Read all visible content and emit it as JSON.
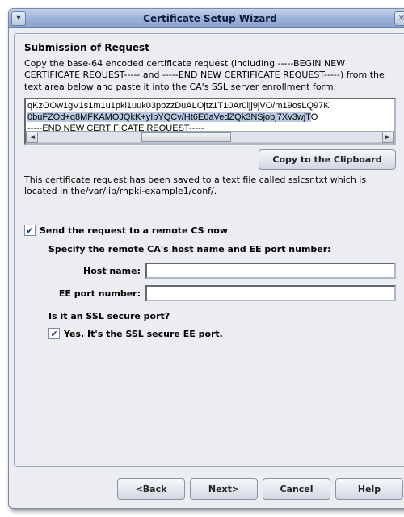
{
  "window": {
    "title": "Certificate Setup Wizard"
  },
  "section": {
    "heading": "Submission of Request",
    "instruction": "Copy the base-64 encoded certificate request (including -----BEGIN NEW CERTIFICATE REQUEST----- and -----END NEW CERTIFICATE REQUEST-----) from the text area below and paste it into the CA's SSL server enrollment form.",
    "cert_line1": "qKzOOw1gV1s1m1u1pkl1uuk03pbzzDuALOjtz1T10Ar0ijj9jVO/m19osLQ97K",
    "cert_line2_sel": "0buFZOd+q8MFKAMOJQkK+yIbYQCv/Ht6E6aVedZQk3NSjobj7Xv3wjT",
    "cert_line2_tail": "O",
    "cert_line3": "-----END NEW CERTIFICATE REQUEST-----",
    "copy_button": "Copy to the Clipboard",
    "saved_note": "This certificate request has been saved to a text file called sslcsr.txt which is located in the/var/lib/rhpki-example1/conf/."
  },
  "remote": {
    "send_label": "Send the request to a remote CS now",
    "send_checked": true,
    "specify_line": "Specify the remote CA's host name and EE port number:",
    "host_label": "Host name:",
    "host_value": "",
    "port_label": "EE port number:",
    "port_value": "",
    "ssl_question": "Is it an SSL secure port?",
    "ssl_yes_label": "Yes. It's the SSL secure EE port.",
    "ssl_yes_checked": true
  },
  "buttons": {
    "back": "<Back",
    "next": "Next>",
    "cancel": "Cancel",
    "help": "Help"
  },
  "icons": {
    "menu_glyph": "▾",
    "close_glyph": "×",
    "left_arrow": "◄",
    "right_arrow": "►",
    "check_glyph": "✔"
  }
}
